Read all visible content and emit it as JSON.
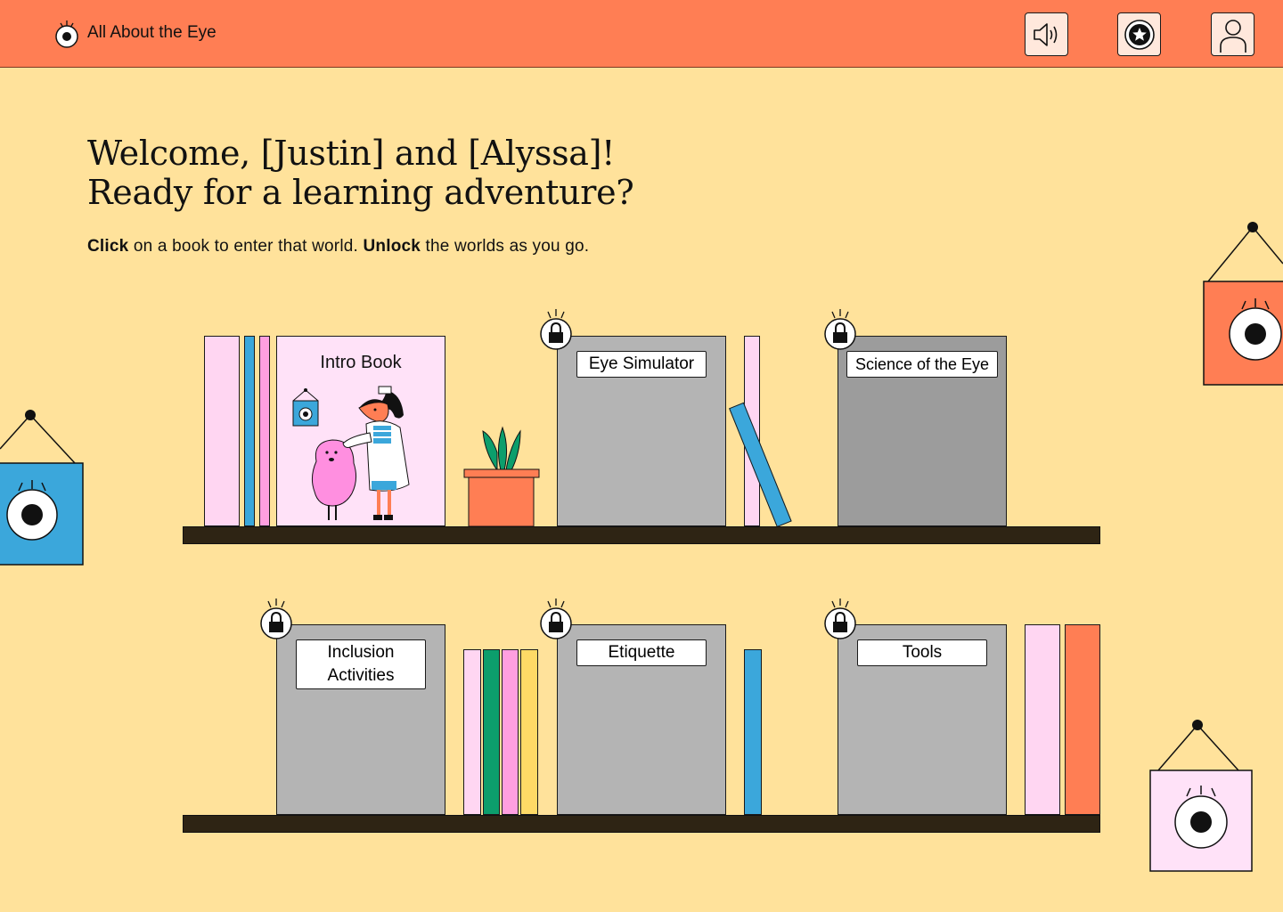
{
  "app": {
    "title": "All About the Eye"
  },
  "header": {
    "sound_icon": "speaker-icon",
    "star_icon": "star-badge-icon",
    "profile_icon": "user-icon"
  },
  "welcome": {
    "line1": "Welcome, [Justin] and [Alyssa]!",
    "line2": "Ready for a learning adventure?"
  },
  "instructions": {
    "click_bold": "Click",
    "click_rest": " on a book to enter that world. ",
    "unlock_bold": "Unlock",
    "unlock_rest": " the worlds as you go."
  },
  "books": {
    "intro": {
      "label": "Intro Book",
      "locked": false
    },
    "eye_simulator": {
      "label": "Eye Simulator",
      "locked": true
    },
    "science": {
      "label": "Science of the Eye",
      "locked": true
    },
    "inclusion": {
      "label_line1": "Inclusion",
      "label_line2": "Activities",
      "locked": true
    },
    "etiquette": {
      "label": "Etiquette",
      "locked": true
    },
    "tools": {
      "label": "Tools",
      "locked": true
    }
  },
  "colors": {
    "background": "#FFE29B",
    "header": "#FF7E54",
    "locked_book": "#B4B4B4",
    "shelf": "#2E2414",
    "pink_light": "#FFD6F2",
    "pink": "#FF9FE0",
    "blue": "#3BA7DB",
    "green": "#0C9E6C",
    "yellow": "#FFDA66",
    "orange": "#FF7E54"
  }
}
